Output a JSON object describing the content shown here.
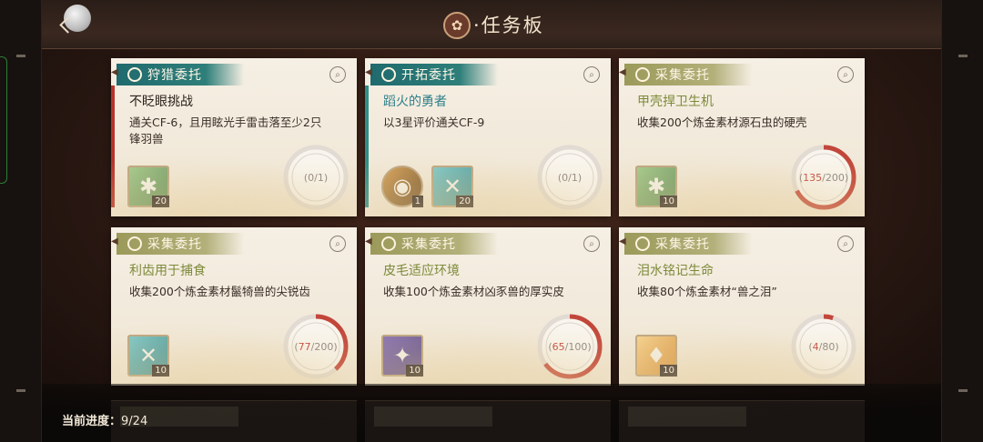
{
  "header": {
    "title_glyph": "✿",
    "title": "·任务板"
  },
  "colors": {
    "hunt_accent": "#b8332b",
    "explore_accent": "#2f8f8a",
    "gather_accent": "#b3b07a",
    "progress_red": "#c2463a"
  },
  "cards": [
    {
      "type": "hunt",
      "tag": "狩猎委托",
      "title": "不眨眼挑战",
      "desc": "通关CF-6，且用眩光手雷击落至少2只锋羽兽",
      "rewards": [
        {
          "icon": "hexagon-material-icon",
          "count": "20",
          "style": "green",
          "glyph": "✱"
        }
      ],
      "progress_current": "0",
      "progress_total": "1",
      "progress_fraction": 0
    },
    {
      "type": "explore",
      "tag": "开拓委托",
      "title": "蹈火的勇者",
      "desc": "以3星评价通关CF-9",
      "rewards": [
        {
          "icon": "grenade-item-icon",
          "count": "1",
          "style": "dark",
          "glyph": "◉"
        },
        {
          "icon": "fang-material-icon",
          "count": "20",
          "style": "teal",
          "glyph": "✕"
        }
      ],
      "progress_current": "0",
      "progress_total": "1",
      "progress_fraction": 0
    },
    {
      "type": "gather",
      "tag": "采集委托",
      "title": "甲壳捍卫生机",
      "desc": "收集200个炼金素材源石虫的硬壳",
      "rewards": [
        {
          "icon": "hexagon-material-icon",
          "count": "10",
          "style": "green",
          "glyph": "✱"
        }
      ],
      "progress_current": "135",
      "progress_total": "200",
      "progress_fraction": 0.675
    },
    {
      "type": "gather",
      "tag": "采集委托",
      "title": "利齿用于捕食",
      "desc": "收集200个炼金素材鬣犄兽的尖锐齿",
      "rewards": [
        {
          "icon": "fang-material-icon",
          "count": "10",
          "style": "teal",
          "glyph": "✕"
        }
      ],
      "progress_current": "77",
      "progress_total": "200",
      "progress_fraction": 0.385
    },
    {
      "type": "gather",
      "tag": "采集委托",
      "title": "皮毛适应环境",
      "desc": "收集100个炼金素材凶豕兽的厚实皮",
      "rewards": [
        {
          "icon": "hide-material-icon",
          "count": "10",
          "style": "purple",
          "glyph": "✦"
        }
      ],
      "progress_current": "65",
      "progress_total": "100",
      "progress_fraction": 0.65
    },
    {
      "type": "gather",
      "tag": "采集委托",
      "title": "泪水铭记生命",
      "desc": "收集80个炼金素材“兽之泪”",
      "rewards": [
        {
          "icon": "tear-material-icon",
          "count": "10",
          "style": "orange",
          "glyph": "♦"
        }
      ],
      "progress_current": "4",
      "progress_total": "80",
      "progress_fraction": 0.05
    }
  ],
  "footer": {
    "progress_label": "当前进度：",
    "progress_value": "9/24"
  }
}
